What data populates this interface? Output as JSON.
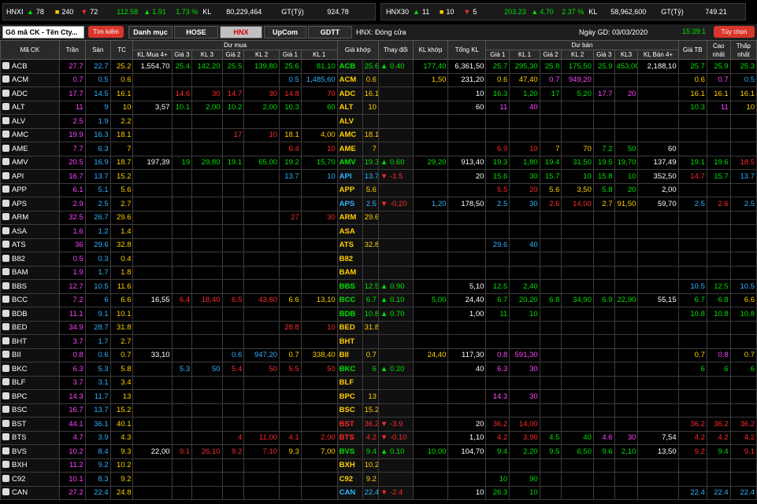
{
  "hnxi": {
    "name": "HNXI",
    "up": "78",
    "ref": "240",
    "dn": "72",
    "value": "112.58",
    "change": "1.91",
    "pct": "1.73 %",
    "kl_label": "KL",
    "kl": "80,229,464",
    "gt_label": "GT(Tỷ)",
    "gt": "924.78"
  },
  "hnx30": {
    "name": "HNX30",
    "up": "11",
    "ref": "10",
    "dn": "5",
    "value": "203.23",
    "change": "4.70",
    "pct": "2.37 %",
    "kl_label": "KL",
    "kl": "58,962,600",
    "gt_label": "GT(Tỷ)",
    "gt": "749.21"
  },
  "toolbar": {
    "search_value": "Gõ mã CK - Tên Cty...",
    "search_btn": "Tìm kiếm",
    "tabs": [
      "Danh mục",
      "HOSE",
      "HNX",
      "UpCom",
      "GDTT"
    ],
    "active_tab": "HNX",
    "status": "HNX:  Đóng cửa",
    "date_label": "Ngày GD:",
    "date": "03/03/2020",
    "time": "15:39:1",
    "options_btn": "Tùy chọn"
  },
  "headers": {
    "ma": "Mã CK",
    "tran": "Trần",
    "san": "Sàn",
    "tc": "TC",
    "du_mua": "Dư mua",
    "gia_khop": "Giá khớp",
    "thay_doi": "Thay đổi",
    "kl_khop": "KL khớp",
    "tong_kl": "Tổng KL",
    "khop": "Khớp",
    "du_ban": "Dư bán",
    "gia_tb": "Giá TB",
    "cao": "Cao nhất",
    "thap": "Thấp nhất",
    "buy_cols": [
      "KL Mua 4+",
      "Giá 3",
      "KL 3",
      "Giá 2",
      "KL 2",
      "Giá 1",
      "KL 1"
    ],
    "sell_cols": [
      "Giá 1",
      "KL 1",
      "Giá 2",
      "KL 2",
      "Giá 3",
      "KL3",
      "KL Bán 4+"
    ]
  },
  "rows": [
    {
      "s": "ACB",
      "ce": "27.7",
      "fl": "22.7",
      "rf": "25.2",
      "b4": "1,554,70",
      "g3": "25.4",
      "k3": "142,20",
      "g2": "25.5",
      "k2": "139,80",
      "g1": "25.6",
      "k1": "81,10",
      "gk": "25.6",
      "ch": "0.40",
      "dir": "up",
      "kk": "177,40",
      "tk": "6,361,50",
      "sg1": "25.7",
      "sk1": "295,30",
      "sg2": "25.8",
      "sk2": "175,50",
      "sg3": "25.9",
      "sk3": "453,00",
      "s4": "2,188,10",
      "tb": "25.7",
      "hi": "25.9",
      "lo": "25.3",
      "c": "up",
      "cg1": "up",
      "cg2": "up",
      "cg3": "up",
      "csg1": "up",
      "csg2": "up",
      "csg3": "up",
      "ctb": "up",
      "chi": "up",
      "clo": "up"
    },
    {
      "s": "ACM",
      "ce": "0.7",
      "fl": "0.5",
      "rf": "0.6",
      "b4": "",
      "g3": "",
      "k3": "",
      "g2": "",
      "k2": "",
      "g1": "0.5",
      "k1": "1,485,60",
      "gk": "0.6",
      "ch": "",
      "dir": "",
      "kk": "1,50",
      "tk": "231,20",
      "sg1": "0.6",
      "sk1": "47,40",
      "sg2": "0.7",
      "sk2": "949,20",
      "sg3": "",
      "sk3": "",
      "s4": "",
      "tb": "0.6",
      "hi": "0.7",
      "lo": "0.5",
      "c": "rf",
      "cg1": "fl",
      "csg1": "rf",
      "csg2": "ce",
      "ctb": "rf",
      "chi": "ce",
      "clo": "fl"
    },
    {
      "s": "ADC",
      "ce": "17.7",
      "fl": "14.5",
      "rf": "16.1",
      "b4": "",
      "g3": "14.6",
      "k3": "30",
      "g2": "14.7",
      "k2": "30",
      "g1": "14.8",
      "k1": "70",
      "gk": "16.1",
      "ch": "",
      "dir": "",
      "kk": "",
      "tk": "10",
      "sg1": "16.3",
      "sk1": "1,20",
      "sg2": "17",
      "sk2": "5,20",
      "sg3": "17.7",
      "sk3": "20",
      "s4": "",
      "tb": "16.1",
      "hi": "16.1",
      "lo": "16.1",
      "c": "rf",
      "cg3": "dn",
      "cg2": "dn",
      "cg1": "dn",
      "csg1": "up",
      "csg2": "up",
      "csg3": "ce",
      "ctb": "rf",
      "chi": "rf",
      "clo": "rf"
    },
    {
      "s": "ALT",
      "ce": "11",
      "fl": "9",
      "rf": "10",
      "b4": "3,57",
      "g3": "10.1",
      "k3": "2,00",
      "g2": "10.2",
      "k2": "2,00",
      "g1": "10.3",
      "k1": "60",
      "gk": "10",
      "ch": "",
      "dir": "",
      "kk": "",
      "tk": "60",
      "sg1": "11",
      "sk1": "40",
      "sg2": "",
      "sk2": "",
      "sg3": "",
      "sk3": "",
      "s4": "",
      "tb": "10.3",
      "hi": "11",
      "lo": "10",
      "c": "rf",
      "cg3": "up",
      "cg2": "up",
      "cg1": "up",
      "csg1": "ce",
      "ctb": "up",
      "chi": "ce",
      "clo": "rf"
    },
    {
      "s": "ALV",
      "ce": "2.5",
      "fl": "1.9",
      "rf": "2.2",
      "b4": "",
      "g3": "",
      "k3": "",
      "g2": "",
      "k2": "",
      "g1": "",
      "k1": "",
      "gk": "",
      "ch": "",
      "dir": "",
      "kk": "",
      "tk": "",
      "sg1": "",
      "sk1": "",
      "sg2": "",
      "sk2": "",
      "sg3": "",
      "sk3": "",
      "s4": "",
      "tb": "",
      "hi": "",
      "lo": "",
      "c": "rf"
    },
    {
      "s": "AMC",
      "ce": "19.9",
      "fl": "16.3",
      "rf": "18.1",
      "b4": "",
      "g3": "",
      "k3": "",
      "g2": "17",
      "k2": "10",
      "g1": "18.1",
      "k1": "4,00",
      "gk": "18.1",
      "ch": "",
      "dir": "",
      "kk": "",
      "tk": "",
      "sg1": "",
      "sk1": "",
      "sg2": "",
      "sk2": "",
      "sg3": "",
      "sk3": "",
      "s4": "",
      "tb": "",
      "hi": "",
      "lo": "",
      "c": "rf",
      "cg2": "dn",
      "cg1": "rf"
    },
    {
      "s": "AME",
      "ce": "7.7",
      "fl": "6.3",
      "rf": "7",
      "b4": "",
      "g3": "",
      "k3": "",
      "g2": "",
      "k2": "",
      "g1": "6.4",
      "k1": "10",
      "gk": "7",
      "ch": "",
      "dir": "",
      "kk": "",
      "tk": "",
      "sg1": "6.9",
      "sk1": "10",
      "sg2": "7",
      "sk2": "70",
      "sg3": "7.2",
      "sk3": "50",
      "s4": "60",
      "tb": "",
      "hi": "",
      "lo": "",
      "c": "rf",
      "cg1": "dn",
      "csg1": "dn",
      "csg2": "rf",
      "csg3": "up"
    },
    {
      "s": "AMV",
      "ce": "20.5",
      "fl": "16.9",
      "rf": "18.7",
      "b4": "197,39",
      "g3": "19",
      "k3": "29,80",
      "g2": "19.1",
      "k2": "65,00",
      "g1": "19.2",
      "k1": "15,70",
      "gk": "19.3",
      "ch": "0.60",
      "dir": "up",
      "kk": "29,20",
      "tk": "913,40",
      "sg1": "19.3",
      "sk1": "1,80",
      "sg2": "19.4",
      "sk2": "31,50",
      "sg3": "19.5",
      "sk3": "19,70",
      "s4": "137,49",
      "tb": "19.1",
      "hi": "19.6",
      "lo": "18.5",
      "c": "up",
      "cg3": "up",
      "cg2": "up",
      "cg1": "up",
      "csg1": "up",
      "csg2": "up",
      "csg3": "up",
      "ctb": "up",
      "chi": "up",
      "clo": "dn"
    },
    {
      "s": "API",
      "ce": "16.7",
      "fl": "13.7",
      "rf": "15.2",
      "b4": "",
      "g3": "",
      "k3": "",
      "g2": "",
      "k2": "",
      "g1": "13.7",
      "k1": "10",
      "gk": "13.7",
      "ch": "-1.5",
      "dir": "dn",
      "kk": "",
      "tk": "20",
      "sg1": "15.6",
      "sk1": "30",
      "sg2": "15.7",
      "sk2": "10",
      "sg3": "15.8",
      "sk3": "10",
      "s4": "352,50",
      "tb": "14.7",
      "hi": "15.7",
      "lo": "13.7",
      "c": "fl",
      "cg1": "fl",
      "csg1": "up",
      "csg2": "up",
      "csg3": "up",
      "ctb": "dn",
      "chi": "up",
      "clo": "fl"
    },
    {
      "s": "APP",
      "ce": "6.1",
      "fl": "5.1",
      "rf": "5.6",
      "b4": "",
      "g3": "",
      "k3": "",
      "g2": "",
      "k2": "",
      "g1": "",
      "k1": "",
      "gk": "5.6",
      "ch": "",
      "dir": "",
      "kk": "",
      "tk": "",
      "sg1": "5.5",
      "sk1": "20",
      "sg2": "5.6",
      "sk2": "3,50",
      "sg3": "5.8",
      "sk3": "20",
      "s4": "2,00",
      "tb": "",
      "hi": "",
      "lo": "",
      "c": "rf",
      "csg1": "dn",
      "csg2": "rf",
      "csg3": "up"
    },
    {
      "s": "APS",
      "ce": "2.9",
      "fl": "2.5",
      "rf": "2.7",
      "b4": "",
      "g3": "",
      "k3": "",
      "g2": "",
      "k2": "",
      "g1": "",
      "k1": "",
      "gk": "2.5",
      "ch": "-0.20",
      "dir": "dn",
      "kk": "1,20",
      "tk": "178,50",
      "sg1": "2.5",
      "sk1": "30",
      "sg2": "2.6",
      "sk2": "14,00",
      "sg3": "2.7",
      "sk3": "91,50",
      "s4": "59,70",
      "tb": "2.5",
      "hi": "2.6",
      "lo": "2.5",
      "c": "fl",
      "csg1": "fl",
      "csg2": "dn",
      "csg3": "rf",
      "ctb": "fl",
      "chi": "dn",
      "clo": "fl"
    },
    {
      "s": "ARM",
      "ce": "32.5",
      "fl": "26.7",
      "rf": "29.6",
      "b4": "",
      "g3": "",
      "k3": "",
      "g2": "",
      "k2": "",
      "g1": "27",
      "k1": "30",
      "gk": "29.6",
      "ch": "",
      "dir": "",
      "kk": "",
      "tk": "",
      "sg1": "",
      "sk1": "",
      "sg2": "",
      "sk2": "",
      "sg3": "",
      "sk3": "",
      "s4": "",
      "tb": "",
      "hi": "",
      "lo": "",
      "c": "rf",
      "cg1": "dn"
    },
    {
      "s": "ASA",
      "ce": "1.6",
      "fl": "1.2",
      "rf": "1.4",
      "b4": "",
      "g3": "",
      "k3": "",
      "g2": "",
      "k2": "",
      "g1": "",
      "k1": "",
      "gk": "",
      "ch": "",
      "dir": "",
      "kk": "",
      "tk": "",
      "sg1": "",
      "sk1": "",
      "sg2": "",
      "sk2": "",
      "sg3": "",
      "sk3": "",
      "s4": "",
      "tb": "",
      "hi": "",
      "lo": "",
      "c": "rf"
    },
    {
      "s": "ATS",
      "ce": "36",
      "fl": "29.6",
      "rf": "32.8",
      "b4": "",
      "g3": "",
      "k3": "",
      "g2": "",
      "k2": "",
      "g1": "",
      "k1": "",
      "gk": "32.8",
      "ch": "",
      "dir": "",
      "kk": "",
      "tk": "",
      "sg1": "29.6",
      "sk1": "40",
      "sg2": "",
      "sk2": "",
      "sg3": "",
      "sk3": "",
      "s4": "",
      "tb": "",
      "hi": "",
      "lo": "",
      "c": "rf",
      "csg1": "fl"
    },
    {
      "s": "B82",
      "ce": "0.5",
      "fl": "0.3",
      "rf": "0.4",
      "b4": "",
      "g3": "",
      "k3": "",
      "g2": "",
      "k2": "",
      "g1": "",
      "k1": "",
      "gk": "",
      "ch": "",
      "dir": "",
      "kk": "",
      "tk": "",
      "sg1": "",
      "sk1": "",
      "sg2": "",
      "sk2": "",
      "sg3": "",
      "sk3": "",
      "s4": "",
      "tb": "",
      "hi": "",
      "lo": "",
      "c": "rf"
    },
    {
      "s": "BAM",
      "ce": "1.9",
      "fl": "1.7",
      "rf": "1.8",
      "b4": "",
      "g3": "",
      "k3": "",
      "g2": "",
      "k2": "",
      "g1": "",
      "k1": "",
      "gk": "",
      "ch": "",
      "dir": "",
      "kk": "",
      "tk": "",
      "sg1": "",
      "sk1": "",
      "sg2": "",
      "sk2": "",
      "sg3": "",
      "sk3": "",
      "s4": "",
      "tb": "",
      "hi": "",
      "lo": "",
      "c": "rf"
    },
    {
      "s": "BBS",
      "ce": "12.7",
      "fl": "10.5",
      "rf": "11.6",
      "b4": "",
      "g3": "",
      "k3": "",
      "g2": "",
      "k2": "",
      "g1": "",
      "k1": "",
      "gk": "12.5",
      "ch": "0.90",
      "dir": "up",
      "kk": "",
      "tk": "5,10",
      "sg1": "12.5",
      "sk1": "2,40",
      "sg2": "",
      "sk2": "",
      "sg3": "",
      "sk3": "",
      "s4": "",
      "tb": "10.5",
      "hi": "12.5",
      "lo": "10.5",
      "c": "up",
      "csg1": "up",
      "ctb": "fl",
      "chi": "up",
      "clo": "fl"
    },
    {
      "s": "BCC",
      "ce": "7.2",
      "fl": "6",
      "rf": "6.6",
      "b4": "16,55",
      "g3": "6.4",
      "k3": "18,40",
      "g2": "6.5",
      "k2": "43,60",
      "g1": "6.6",
      "k1": "13,10",
      "gk": "6.7",
      "ch": "0.10",
      "dir": "up",
      "kk": "5,00",
      "tk": "24,40",
      "sg1": "6.7",
      "sk1": "20,20",
      "sg2": "6.8",
      "sk2": "34,90",
      "sg3": "6.9",
      "sk3": "22,90",
      "s4": "55,15",
      "tb": "6.7",
      "hi": "6.8",
      "lo": "6.6",
      "c": "up",
      "cg3": "dn",
      "cg2": "dn",
      "cg1": "rf",
      "csg1": "up",
      "csg2": "up",
      "csg3": "up",
      "ctb": "up",
      "chi": "up",
      "clo": "rf"
    },
    {
      "s": "BDB",
      "ce": "11.1",
      "fl": "9.1",
      "rf": "10.1",
      "b4": "",
      "g3": "",
      "k3": "",
      "g2": "",
      "k2": "",
      "g1": "",
      "k1": "",
      "gk": "10.8",
      "ch": "0.70",
      "dir": "up",
      "kk": "",
      "tk": "1,00",
      "sg1": "11",
      "sk1": "10",
      "sg2": "",
      "sk2": "",
      "sg3": "",
      "sk3": "",
      "s4": "",
      "tb": "10.8",
      "hi": "10.8",
      "lo": "10.8",
      "c": "up",
      "csg1": "up",
      "ctb": "up",
      "chi": "up",
      "clo": "up"
    },
    {
      "s": "BED",
      "ce": "34.9",
      "fl": "28.7",
      "rf": "31.8",
      "b4": "",
      "g3": "",
      "k3": "",
      "g2": "",
      "k2": "",
      "g1": "28.8",
      "k1": "10",
      "gk": "31.8",
      "ch": "",
      "dir": "",
      "kk": "",
      "tk": "",
      "sg1": "",
      "sk1": "",
      "sg2": "",
      "sk2": "",
      "sg3": "",
      "sk3": "",
      "s4": "",
      "tb": "",
      "hi": "",
      "lo": "",
      "c": "rf",
      "cg1": "dn"
    },
    {
      "s": "BHT",
      "ce": "3.7",
      "fl": "1.7",
      "rf": "2.7",
      "b4": "",
      "g3": "",
      "k3": "",
      "g2": "",
      "k2": "",
      "g1": "",
      "k1": "",
      "gk": "",
      "ch": "",
      "dir": "",
      "kk": "",
      "tk": "",
      "sg1": "",
      "sk1": "",
      "sg2": "",
      "sk2": "",
      "sg3": "",
      "sk3": "",
      "s4": "",
      "tb": "",
      "hi": "",
      "lo": "",
      "c": "rf"
    },
    {
      "s": "BII",
      "ce": "0.8",
      "fl": "0.6",
      "rf": "0.7",
      "b4": "33,10",
      "g3": "",
      "k3": "",
      "g2": "0.6",
      "k2": "947,20",
      "g1": "0.7",
      "k1": "338,40",
      "gk": "0.7",
      "ch": "",
      "dir": "",
      "kk": "24,40",
      "tk": "117,30",
      "sg1": "0.8",
      "sk1": "591,30",
      "sg2": "",
      "sk2": "",
      "sg3": "",
      "sk3": "",
      "s4": "",
      "tb": "0.7",
      "hi": "0.8",
      "lo": "0.7",
      "c": "rf",
      "cg2": "fl",
      "cg1": "rf",
      "csg1": "ce",
      "ctb": "rf",
      "chi": "ce",
      "clo": "rf"
    },
    {
      "s": "BKC",
      "ce": "6.3",
      "fl": "5.3",
      "rf": "5.8",
      "b4": "",
      "g3": "5.3",
      "k3": "50",
      "g2": "5.4",
      "k2": "50",
      "g1": "5.5",
      "k1": "50",
      "gk": "6",
      "ch": "0.20",
      "dir": "up",
      "kk": "",
      "tk": "40",
      "sg1": "6.3",
      "sk1": "30",
      "sg2": "",
      "sk2": "",
      "sg3": "",
      "sk3": "",
      "s4": "",
      "tb": "6",
      "hi": "6",
      "lo": "6",
      "c": "up",
      "cg3": "fl",
      "cg2": "dn",
      "cg1": "dn",
      "csg1": "ce",
      "ctb": "up",
      "chi": "up",
      "clo": "up"
    },
    {
      "s": "BLF",
      "ce": "3.7",
      "fl": "3.1",
      "rf": "3.4",
      "b4": "",
      "g3": "",
      "k3": "",
      "g2": "",
      "k2": "",
      "g1": "",
      "k1": "",
      "gk": "",
      "ch": "",
      "dir": "",
      "kk": "",
      "tk": "",
      "sg1": "",
      "sk1": "",
      "sg2": "",
      "sk2": "",
      "sg3": "",
      "sk3": "",
      "s4": "",
      "tb": "",
      "hi": "",
      "lo": "",
      "c": "rf"
    },
    {
      "s": "BPC",
      "ce": "14.3",
      "fl": "11.7",
      "rf": "13",
      "b4": "",
      "g3": "",
      "k3": "",
      "g2": "",
      "k2": "",
      "g1": "",
      "k1": "",
      "gk": "13",
      "ch": "",
      "dir": "",
      "kk": "",
      "tk": "",
      "sg1": "14.3",
      "sk1": "30",
      "sg2": "",
      "sk2": "",
      "sg3": "",
      "sk3": "",
      "s4": "",
      "tb": "",
      "hi": "",
      "lo": "",
      "c": "rf",
      "csg1": "ce"
    },
    {
      "s": "BSC",
      "ce": "16.7",
      "fl": "13.7",
      "rf": "15.2",
      "b4": "",
      "g3": "",
      "k3": "",
      "g2": "",
      "k2": "",
      "g1": "",
      "k1": "",
      "gk": "15.2",
      "ch": "",
      "dir": "",
      "kk": "",
      "tk": "",
      "sg1": "",
      "sk1": "",
      "sg2": "",
      "sk2": "",
      "sg3": "",
      "sk3": "",
      "s4": "",
      "tb": "",
      "hi": "",
      "lo": "",
      "c": "rf"
    },
    {
      "s": "BST",
      "ce": "44.1",
      "fl": "36.1",
      "rf": "40.1",
      "b4": "",
      "g3": "",
      "k3": "",
      "g2": "",
      "k2": "",
      "g1": "",
      "k1": "",
      "gk": "36.2",
      "ch": "-3.9",
      "dir": "dn",
      "kk": "",
      "tk": "20",
      "sg1": "36.2",
      "sk1": "14,00",
      "sg2": "",
      "sk2": "",
      "sg3": "",
      "sk3": "",
      "s4": "",
      "tb": "36.2",
      "hi": "36.2",
      "lo": "36.2",
      "c": "dn",
      "csg1": "dn",
      "ctb": "dn",
      "chi": "dn",
      "clo": "dn"
    },
    {
      "s": "BTS",
      "ce": "4.7",
      "fl": "3.9",
      "rf": "4.3",
      "b4": "",
      "g3": "",
      "k3": "",
      "g2": "4",
      "k2": "11,00",
      "g1": "4.1",
      "k1": "2,00",
      "gk": "4.2",
      "ch": "-0.10",
      "dir": "dn",
      "kk": "",
      "tk": "1,10",
      "sg1": "4.2",
      "sk1": "3,90",
      "sg2": "4.5",
      "sk2": "40",
      "sg3": "4.6",
      "sk3": "30",
      "s4": "7,54",
      "tb": "4.2",
      "hi": "4.2",
      "lo": "4.2",
      "c": "dn",
      "cg2": "dn",
      "cg1": "dn",
      "csg1": "dn",
      "csg2": "up",
      "csg3": "ce",
      "ctb": "dn",
      "chi": "dn",
      "clo": "dn"
    },
    {
      "s": "BVS",
      "ce": "10.2",
      "fl": "8.4",
      "rf": "9.3",
      "b4": "22,00",
      "g3": "9.1",
      "k3": "26,10",
      "g2": "9.2",
      "k2": "7,10",
      "g1": "9.3",
      "k1": "7,00",
      "gk": "9.4",
      "ch": "0.10",
      "dir": "up",
      "kk": "10,00",
      "tk": "104,70",
      "sg1": "9.4",
      "sk1": "2,20",
      "sg2": "9.5",
      "sk2": "6,50",
      "sg3": "9.6",
      "sk3": "2,10",
      "s4": "13,50",
      "tb": "9.2",
      "hi": "9.4",
      "lo": "9.1",
      "c": "up",
      "cg3": "dn",
      "cg2": "dn",
      "cg1": "rf",
      "csg1": "up",
      "csg2": "up",
      "csg3": "up",
      "ctb": "dn",
      "chi": "up",
      "clo": "dn"
    },
    {
      "s": "BXH",
      "ce": "11.2",
      "fl": "9.2",
      "rf": "10.2",
      "b4": "",
      "g3": "",
      "k3": "",
      "g2": "",
      "k2": "",
      "g1": "",
      "k1": "",
      "gk": "10.2",
      "ch": "",
      "dir": "",
      "kk": "",
      "tk": "",
      "sg1": "",
      "sk1": "",
      "sg2": "",
      "sk2": "",
      "sg3": "",
      "sk3": "",
      "s4": "",
      "tb": "",
      "hi": "",
      "lo": "",
      "c": "rf"
    },
    {
      "s": "C92",
      "ce": "10.1",
      "fl": "8.3",
      "rf": "9.2",
      "b4": "",
      "g3": "",
      "k3": "",
      "g2": "",
      "k2": "",
      "g1": "",
      "k1": "",
      "gk": "9.2",
      "ch": "",
      "dir": "",
      "kk": "",
      "tk": "",
      "sg1": "10",
      "sk1": "90",
      "sg2": "",
      "sk2": "",
      "sg3": "",
      "sk3": "",
      "s4": "",
      "tb": "",
      "hi": "",
      "lo": "",
      "c": "rf",
      "csg1": "up"
    },
    {
      "s": "CAN",
      "ce": "27.2",
      "fl": "22.4",
      "rf": "24.8",
      "b4": "",
      "g3": "",
      "k3": "",
      "g2": "",
      "k2": "",
      "g1": "",
      "k1": "",
      "gk": "22.4",
      "ch": "-2.4",
      "dir": "dn",
      "kk": "",
      "tk": "10",
      "sg1": "26.3",
      "sk1": "10",
      "sg2": "",
      "sk2": "",
      "sg3": "",
      "sk3": "",
      "s4": "",
      "tb": "22.4",
      "hi": "22.4",
      "lo": "22.4",
      "c": "fl",
      "csg1": "up",
      "ctb": "fl",
      "chi": "fl",
      "clo": "fl"
    }
  ],
  "colors": {
    "ceiling": "#ff44ff",
    "floor": "#2fb2ff",
    "reference": "#ffd000",
    "up": "#00e000",
    "down": "#ff2a2a",
    "header_bg": "#2a2a2a",
    "active_tab_text": "#d40000",
    "button_red": "#d9352b"
  }
}
